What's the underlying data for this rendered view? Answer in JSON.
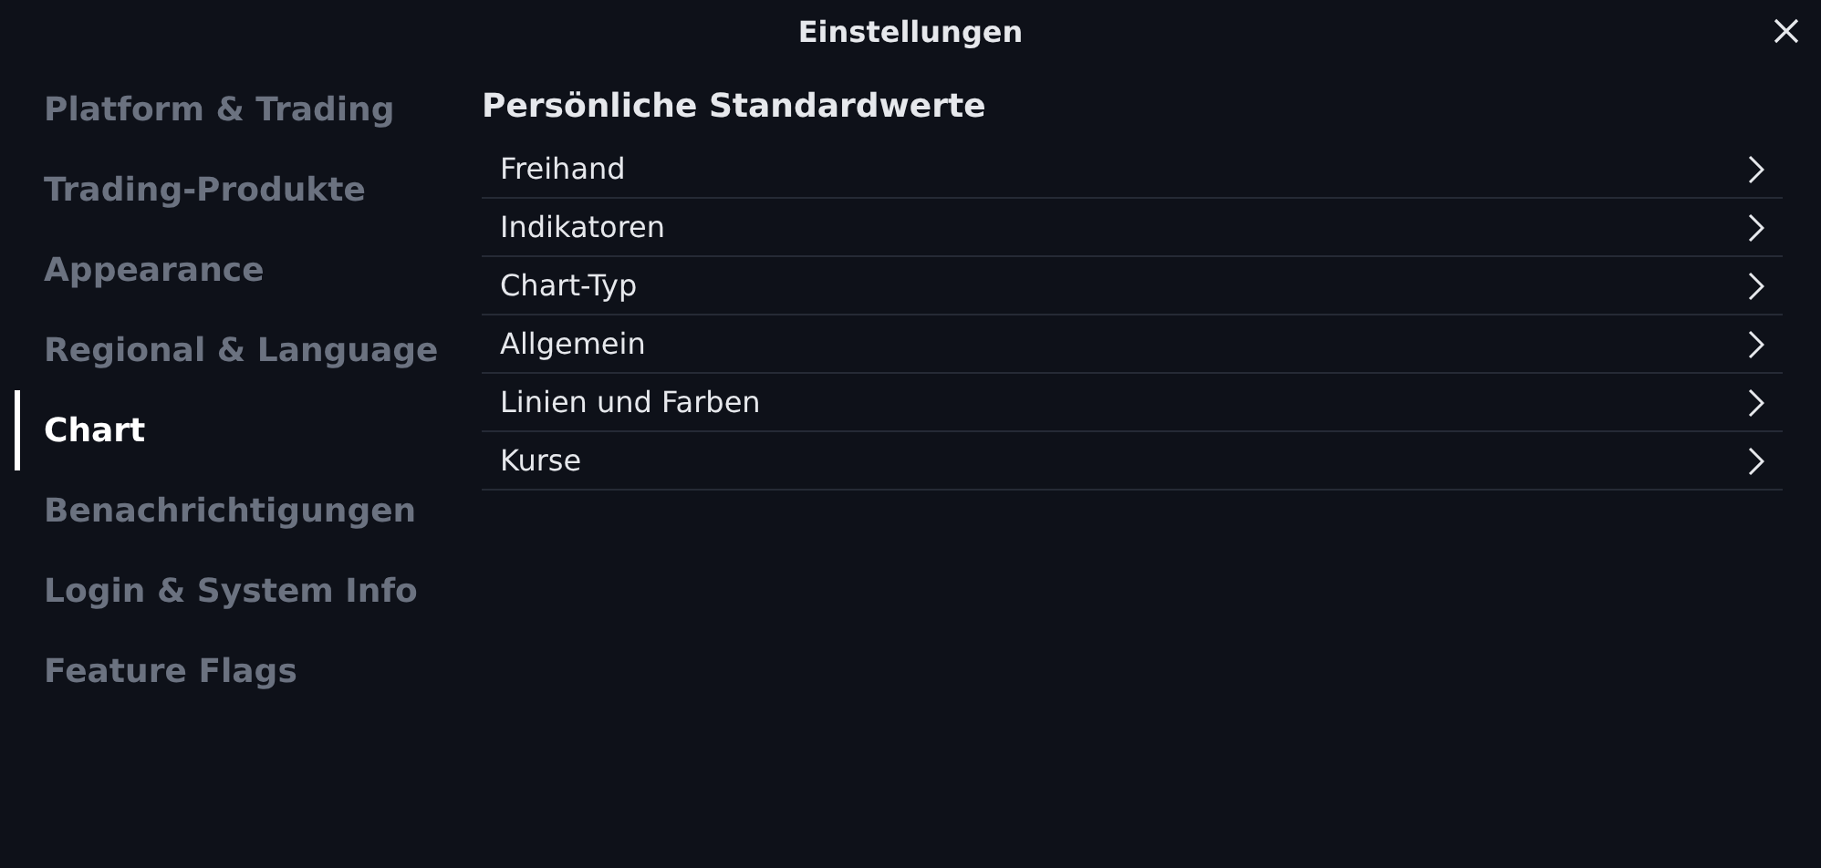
{
  "window": {
    "title": "Einstellungen"
  },
  "sidebar": {
    "items": [
      {
        "label": "Platform & Trading",
        "selected": false
      },
      {
        "label": "Trading-Produkte",
        "selected": false
      },
      {
        "label": "Appearance",
        "selected": false
      },
      {
        "label": "Regional & Language",
        "selected": false
      },
      {
        "label": "Chart",
        "selected": true
      },
      {
        "label": "Benachrichtigungen",
        "selected": false
      },
      {
        "label": "Login & System Info",
        "selected": false
      },
      {
        "label": "Feature Flags",
        "selected": false
      }
    ]
  },
  "section": {
    "title": "Persönliche Standardwerte",
    "items": [
      {
        "label": "Freihand"
      },
      {
        "label": "Indikatoren"
      },
      {
        "label": "Chart-Typ"
      },
      {
        "label": "Allgemein"
      },
      {
        "label": "Linien und Farben"
      },
      {
        "label": "Kurse"
      }
    ]
  }
}
